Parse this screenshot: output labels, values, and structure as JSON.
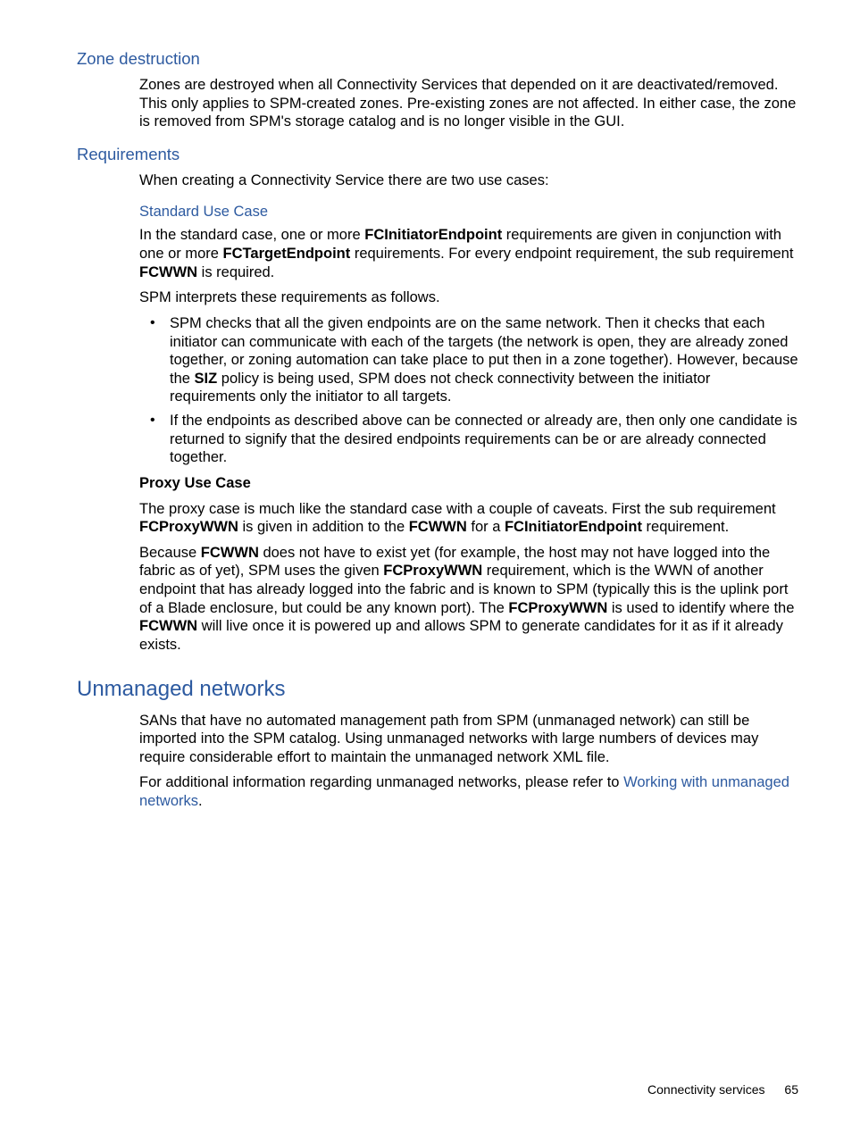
{
  "sections": {
    "zone_destruction": {
      "title": "Zone destruction",
      "p1": "Zones are destroyed when all Connectivity Services that depended on it are deactivated/removed. This only applies to SPM-created zones. Pre-existing zones are not affected. In either case, the zone is removed from SPM's storage catalog and is no longer visible in the GUI."
    },
    "requirements": {
      "title": "Requirements",
      "p1": "When creating a Connectivity Service there are two use cases:",
      "standard": {
        "title": "Standard Use Case",
        "p1_a": "In the standard case, one or more ",
        "p1_b": "FCInitiatorEndpoint",
        "p1_c": " requirements are given in conjunction with one or more ",
        "p1_d": "FCTargetEndpoint",
        "p1_e": " requirements. For every endpoint requirement, the sub requirement ",
        "p1_f": "FCWWN",
        "p1_g": " is required.",
        "p2": "SPM interprets these requirements as follows.",
        "li1_a": "SPM checks that all the given endpoints are on the same network. Then it checks that each initiator can communicate with each of the targets (the network is open, they are already zoned together, or zoning automation can take place to put then in a zone together). However, because the ",
        "li1_b": "SIZ",
        "li1_c": " policy is being used, SPM does not check connectivity between the initiator requirements only the initiator to all targets.",
        "li2": "If the endpoints as described above can be connected or already are, then only one candidate is returned to signify that the desired endpoints requirements can be or are already connected together."
      },
      "proxy": {
        "title": "Proxy Use Case",
        "p1_a": "The proxy case is much like the standard case with a couple of caveats. First the sub requirement ",
        "p1_b": "FCProxyWWN",
        "p1_c": " is given in addition to the ",
        "p1_d": "FCWWN",
        "p1_e": " for a ",
        "p1_f": "FCInitiatorEndpoint",
        "p1_g": " requirement.",
        "p2_a": "Because ",
        "p2_b": "FCWWN",
        "p2_c": " does not have to exist yet (for example, the host may not have logged into the fabric as of yet), SPM uses the given ",
        "p2_d": "FCProxyWWN",
        "p2_e": " requirement, which is the WWN of another endpoint that has already logged into the fabric and is known to SPM (typically this is the uplink port of a Blade enclosure, but could be any known port). The ",
        "p2_f": "FCProxyWWN",
        "p2_g": " is used to identify where the ",
        "p2_h": "FCWWN",
        "p2_i": " will live once it is powered up and allows SPM to generate candidates for it as if it already exists."
      }
    },
    "unmanaged": {
      "title": "Unmanaged networks",
      "p1": "SANs that have no automated management path from SPM (unmanaged network) can still be imported into the SPM catalog. Using unmanaged networks with large numbers of devices may require considerable effort to maintain the unmanaged network XML file.",
      "p2_a": "For additional information regarding unmanaged networks, please refer to ",
      "p2_link": "Working with unmanaged networks",
      "p2_b": "."
    }
  },
  "footer": {
    "section": "Connectivity services",
    "page": "65"
  }
}
